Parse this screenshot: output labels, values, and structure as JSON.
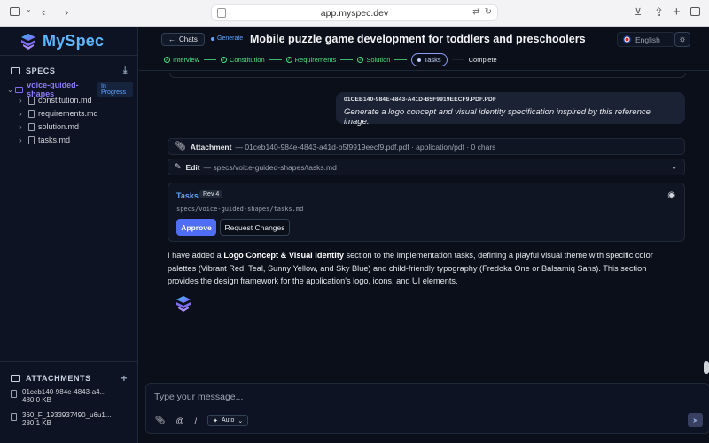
{
  "browser": {
    "url": "app.myspec.dev"
  },
  "colors": {
    "accent": "#4f6df5",
    "brand": "#5eb8ff",
    "success": "#4ade80",
    "link": "#60a5fa",
    "background": "#0b0f1a"
  },
  "sidebar": {
    "logo": "MySpec",
    "specs_header": "SPECS",
    "spec_name": "voice-guided-shapes",
    "spec_status": "In Progress",
    "files": [
      "constitution.md",
      "requirements.md",
      "solution.md",
      "tasks.md"
    ],
    "attachments_header": "ATTACHMENTS",
    "attachments": [
      {
        "name": "01ceb140-984e-4843-a4...",
        "size": "480.0 KB"
      },
      {
        "name": "360_F_1933937490_u6u1...",
        "size": "280.1 KB"
      }
    ]
  },
  "header": {
    "back_label": "Chats",
    "status": "Generate",
    "title": "Mobile puzzle game development for toddlers and preschoolers",
    "language": "English",
    "steps": [
      "Interview",
      "Constitution",
      "Requirements",
      "Solution",
      "Tasks",
      "Complete"
    ]
  },
  "messages": {
    "user_attachment_name": "01CEB140-984E-4843-A41D-B5F9919EECF9.PDF.PDF",
    "user_text": "Generate a logo concept and visual identity specification inspired by this reference image.",
    "attachment_row": {
      "label": "Attachment",
      "detail": "— 01ceb140-984e-4843-a41d-b5f9919eecf9.pdf.pdf · application/pdf · 0 chars"
    },
    "edit_row": {
      "label": "Edit",
      "detail": "— specs/voice-guided-shapes/tasks.md"
    },
    "tasks_card": {
      "title": "Tasks",
      "revision": "Rev 4",
      "path": "specs/voice-guided-shapes/tasks.md",
      "approve_label": "Approve",
      "request_label": "Request Changes"
    },
    "assistant_pre": "I have added a ",
    "assistant_bold": "Logo Concept & Visual Identity",
    "assistant_post": " section to the implementation tasks, defining a playful visual theme with specific color palettes (Vibrant Red, Teal, Sunny Yellow, and Sky Blue) and child-friendly typography (Fredoka One or Balsamiq Sans). This section provides the design framework for the application's logo, icons, and UI elements."
  },
  "composer": {
    "placeholder": "Type your message...",
    "mode": "Auto"
  }
}
